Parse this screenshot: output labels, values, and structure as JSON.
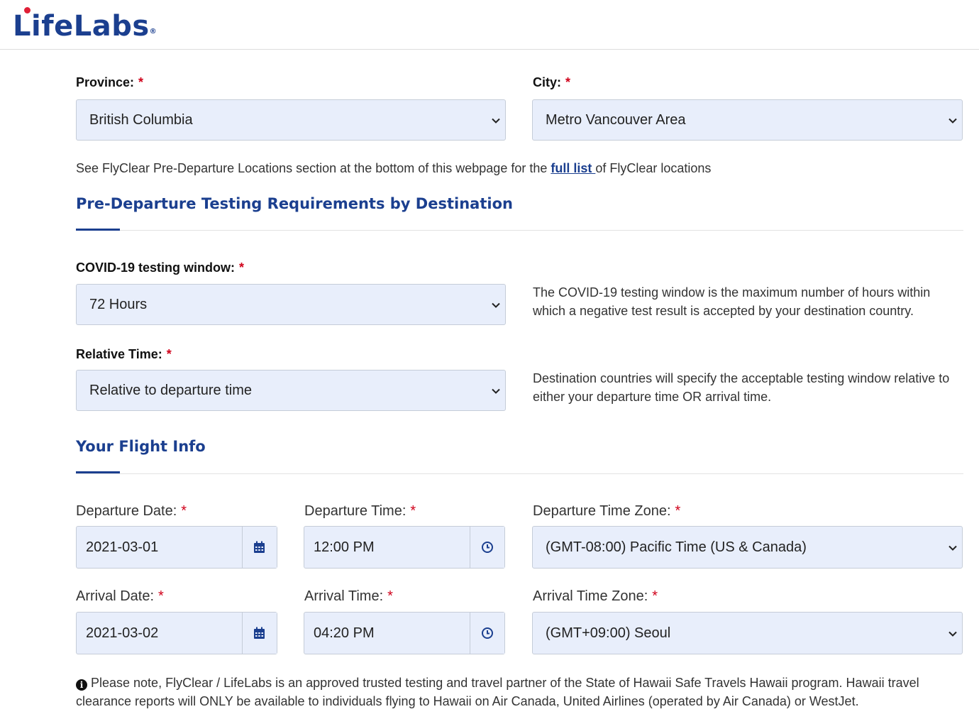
{
  "brand": {
    "logo_text": "LifeLabs",
    "reg_mark": "®"
  },
  "location": {
    "province_label": "Province:",
    "province_value": "British Columbia",
    "city_label": "City:",
    "city_value": "Metro Vancouver Area",
    "note_prefix": "See FlyClear Pre-Departure Locations section at the bottom of this webpage for the ",
    "note_link": "full list ",
    "note_suffix": "of FlyClear locations"
  },
  "required_mark": "*",
  "requirements": {
    "title": "Pre-Departure Testing Requirements by Destination",
    "window_label": "COVID-19 testing window:",
    "window_value": "72 Hours",
    "window_help": "The COVID-19 testing window is the maximum number of hours within which a negative test result is accepted by your destination country.",
    "relative_label": "Relative Time:",
    "relative_value": "Relative to departure time",
    "relative_help": "Destination countries will specify the acceptable testing window relative to either your departure time OR arrival time."
  },
  "flight": {
    "title": "Your Flight Info",
    "departure_date_label": "Departure Date:",
    "departure_date_value": "2021-03-01",
    "departure_time_label": "Departure Time:",
    "departure_time_value": "12:00 PM",
    "departure_tz_label": "Departure Time Zone:",
    "departure_tz_value": "(GMT-08:00) Pacific Time (US & Canada)",
    "arrival_date_label": "Arrival Date:",
    "arrival_date_value": "2021-03-02",
    "arrival_time_label": "Arrival Time:",
    "arrival_time_value": "04:20 PM",
    "arrival_tz_label": "Arrival Time Zone:",
    "arrival_tz_value": "(GMT+09:00) Seoul"
  },
  "footer_note": {
    "icon": "info-icon",
    "text": "Please note, FlyClear / LifeLabs is an approved trusted testing and travel partner of the State of Hawaii Safe Travels Hawaii program. Hawaii travel clearance reports will ONLY be available to individuals flying to Hawaii on Air Canada, United Airlines (operated by Air Canada) or WestJet."
  },
  "colors": {
    "brand_blue": "#1b3f8f",
    "brand_red": "#e01f36",
    "required_red": "#d0021b",
    "field_bg": "#e8eefb"
  }
}
